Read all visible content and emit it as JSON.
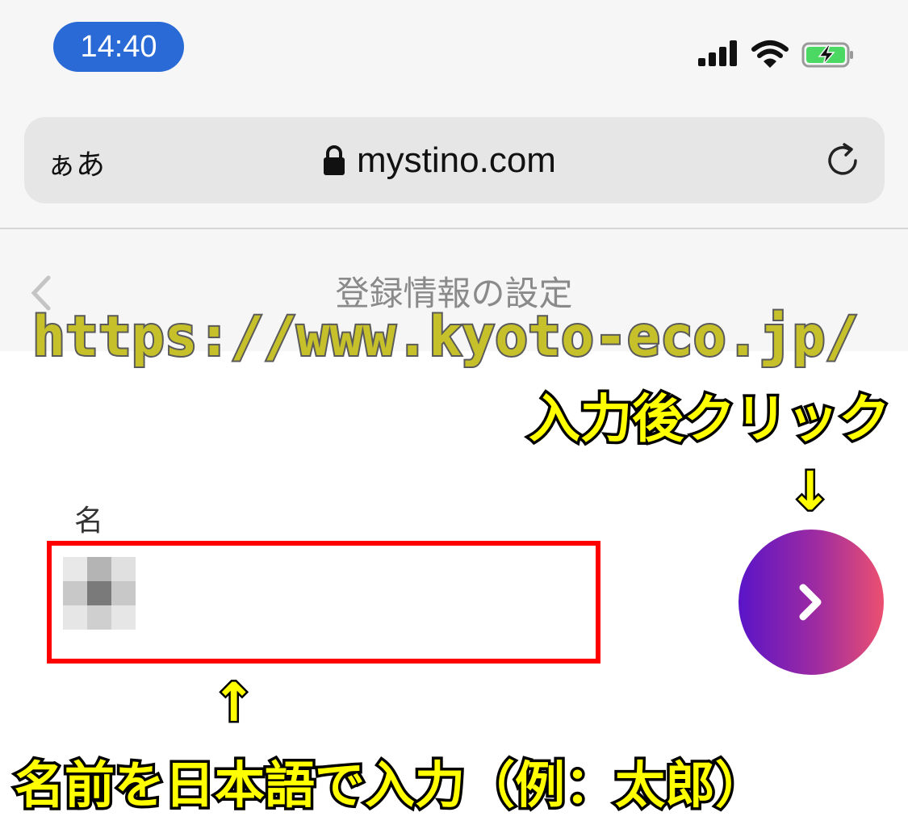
{
  "status_bar": {
    "time": "14:40"
  },
  "browser": {
    "text_size_button": "ぁあ",
    "url": "mystino.com"
  },
  "page": {
    "title": "登録情報の設定",
    "field_label": "名"
  },
  "annotations": {
    "url_overlay": "https://www.kyoto-eco.jp/",
    "click_hint": "入力後クリック",
    "down_arrow": "↓",
    "up_arrow": "↑",
    "instruction": "名前を日本語で入力（例：太郎）"
  },
  "colors": {
    "time_pill": "#2a6ad6",
    "input_border": "#ff0000",
    "button_gradient_start": "#5a14c8",
    "button_gradient_end": "#ec5070",
    "annotation_text": "#ffff00"
  }
}
